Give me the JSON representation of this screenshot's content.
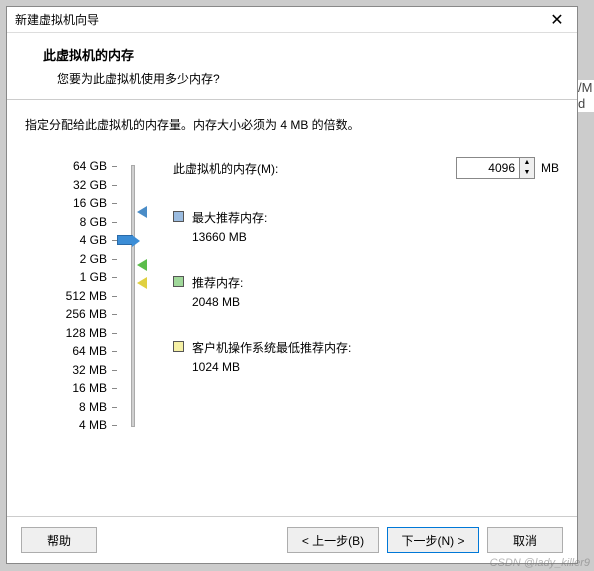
{
  "window": {
    "title": "新建虚拟机向导"
  },
  "header": {
    "heading": "此虚拟机的内存",
    "sub": "您要为此虚拟机使用多少内存?"
  },
  "instruction": "指定分配给此虚拟机的内存量。内存大小必须为 4 MB 的倍数。",
  "memory": {
    "label": "此虚拟机的内存(M):",
    "value": "4096",
    "unit": "MB"
  },
  "scale": [
    "64 GB",
    "32 GB",
    "16 GB",
    "8 GB",
    "4 GB",
    "2 GB",
    "1 GB",
    "512 MB",
    "256 MB",
    "128 MB",
    "64 MB",
    "32 MB",
    "16 MB",
    "8 MB",
    "4 MB"
  ],
  "recommendations": {
    "max": {
      "title": "最大推荐内存:",
      "value": "13660 MB"
    },
    "rec": {
      "title": "推荐内存:",
      "value": "2048 MB"
    },
    "min": {
      "title": "客户机操作系统最低推荐内存:",
      "value": "1024 MB"
    }
  },
  "buttons": {
    "help": "帮助",
    "back": "< 上一步(B)",
    "next": "下一步(N) >",
    "cancel": "取消"
  },
  "watermark": "CSDN @lady_killer9",
  "chart_data": {
    "type": "bar",
    "note": "Vertical memory slider; tick labels are powers of two from 4 MB to 64 GB.",
    "ticks": [
      "64 GB",
      "32 GB",
      "16 GB",
      "8 GB",
      "4 GB",
      "2 GB",
      "1 GB",
      "512 MB",
      "256 MB",
      "128 MB",
      "64 MB",
      "32 MB",
      "16 MB",
      "8 MB",
      "4 MB"
    ],
    "selected_mb": 4096,
    "markers": [
      {
        "name": "max_recommended",
        "value_mb": 13660,
        "color": "blue"
      },
      {
        "name": "recommended",
        "value_mb": 2048,
        "color": "green"
      },
      {
        "name": "min_recommended",
        "value_mb": 1024,
        "color": "yellow"
      }
    ]
  },
  "bg": {
    "a": "/M",
    "b": "d"
  }
}
